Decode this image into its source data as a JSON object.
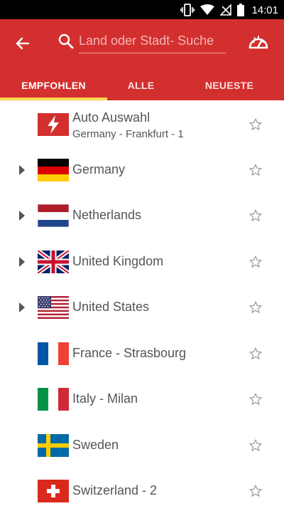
{
  "status_bar": {
    "time": "14:01",
    "icons": [
      "vibrate-icon",
      "wifi-icon",
      "no-signal-icon",
      "battery-icon"
    ]
  },
  "app_bar": {
    "back_icon": "arrow-left-icon",
    "search": {
      "placeholder": "Land oder Stadt- Suche",
      "value": ""
    },
    "speedtest_icon": "speedometer-icon",
    "background_color": "#d32f2f",
    "tab_indicator_color": "#ffd54f"
  },
  "tabs": [
    {
      "label": "EMPFOHLEN",
      "active": true
    },
    {
      "label": "ALLE",
      "active": false
    },
    {
      "label": "NEUESTE",
      "active": false
    }
  ],
  "locations": [
    {
      "name": "Auto Auswahl",
      "subtitle": "Germany - Frankfurt - 1",
      "flag": "auto-lightning",
      "expandable": false,
      "favorite": false
    },
    {
      "name": "Germany",
      "flag": "de",
      "expandable": true,
      "favorite": false
    },
    {
      "name": "Netherlands",
      "flag": "nl",
      "expandable": true,
      "favorite": false
    },
    {
      "name": "United Kingdom",
      "flag": "gb",
      "expandable": true,
      "favorite": false
    },
    {
      "name": "United States",
      "flag": "us",
      "expandable": true,
      "favorite": false
    },
    {
      "name": "France - Strasbourg",
      "flag": "fr",
      "expandable": false,
      "favorite": false
    },
    {
      "name": "Italy - Milan",
      "flag": "it",
      "expandable": false,
      "favorite": false
    },
    {
      "name": "Sweden",
      "flag": "se",
      "expandable": false,
      "favorite": false
    },
    {
      "name": "Switzerland - 2",
      "flag": "ch",
      "expandable": false,
      "favorite": false
    }
  ]
}
